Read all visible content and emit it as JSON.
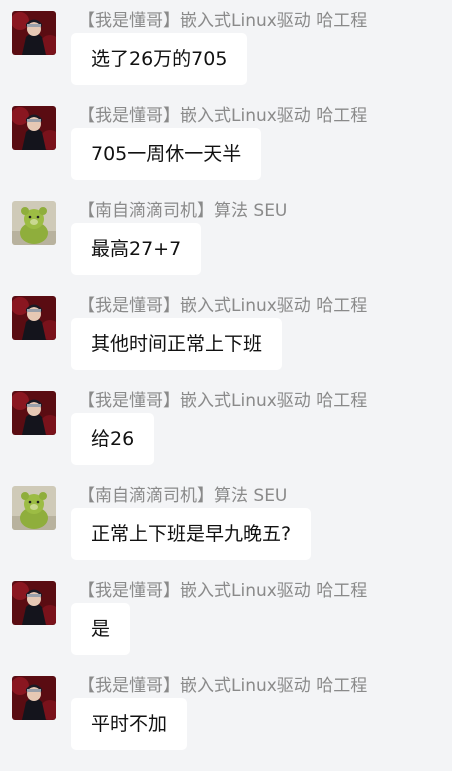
{
  "colors": {
    "background": "#f3f4f6",
    "bubble": "#ffffff",
    "sender_text": "#8a8a8a",
    "message_text": "#111111"
  },
  "messages": [
    {
      "avatar": "ninja-avatar-icon",
      "sender": "【我是懂哥】嵌入式Linux驱动 哈工程",
      "text": "选了26万的705"
    },
    {
      "avatar": "ninja-avatar-icon",
      "sender": "【我是懂哥】嵌入式Linux驱动 哈工程",
      "text": "705一周休一天半"
    },
    {
      "avatar": "bear-avatar-icon",
      "sender": "【南自滴滴司机】算法  SEU",
      "text": "最高27+7"
    },
    {
      "avatar": "ninja-avatar-icon",
      "sender": "【我是懂哥】嵌入式Linux驱动 哈工程",
      "text": "其他时间正常上下班"
    },
    {
      "avatar": "ninja-avatar-icon",
      "sender": "【我是懂哥】嵌入式Linux驱动 哈工程",
      "text": "给26"
    },
    {
      "avatar": "bear-avatar-icon",
      "sender": "【南自滴滴司机】算法  SEU",
      "text": "正常上下班是早九晚五?"
    },
    {
      "avatar": "ninja-avatar-icon",
      "sender": "【我是懂哥】嵌入式Linux驱动 哈工程",
      "text": "是"
    },
    {
      "avatar": "ninja-avatar-icon",
      "sender": "【我是懂哥】嵌入式Linux驱动 哈工程",
      "text": "平时不加"
    }
  ]
}
